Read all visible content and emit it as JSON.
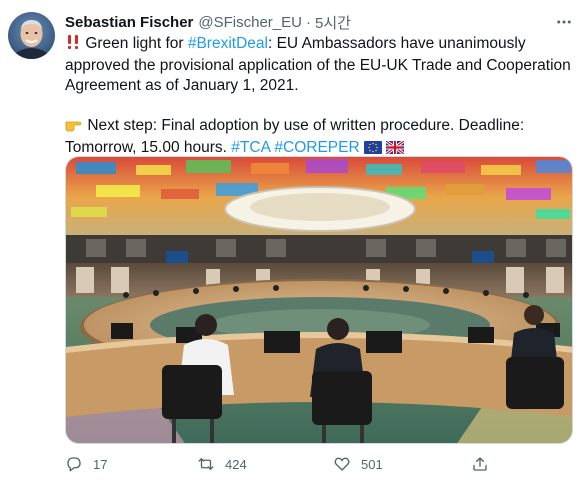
{
  "author": {
    "name": "Sebastian Fischer",
    "handle": "@SFischer_EU",
    "separator": "·",
    "time": "5시간"
  },
  "tweet": {
    "line1_lead": "Green light for ",
    "hashtag_brexit": "#BrexitDeal",
    "line1_rest": ": EU Ambassadors have unanimously approved the provisional application of the EU-UK Trade and Cooperation Agreement as of January 1, 2021.",
    "line2": "Next step: Final adoption by use of written procedure. Deadline: Tomorrow, 15.00 hours.",
    "hashtag_tca": "#TCA",
    "hashtag_coreper": "#COREPER"
  },
  "actions": {
    "reply_count": "17",
    "retweet_count": "424",
    "like_count": "501"
  },
  "icons": {
    "double_exclamation": "double-exclamation-emoji",
    "pointing_hand": "pointing-right-hand-emoji",
    "eu_flag": "eu-flag-emoji",
    "uk_flag": "uk-flag-emoji",
    "more": "more-icon",
    "reply": "reply-icon",
    "retweet": "retweet-icon",
    "like": "like-icon",
    "share": "share-icon"
  },
  "colors": {
    "link": "#1d9bf0",
    "secondary_text": "#536471",
    "primary_text": "#0f1419",
    "exclamation_red": "#d32a2a"
  }
}
